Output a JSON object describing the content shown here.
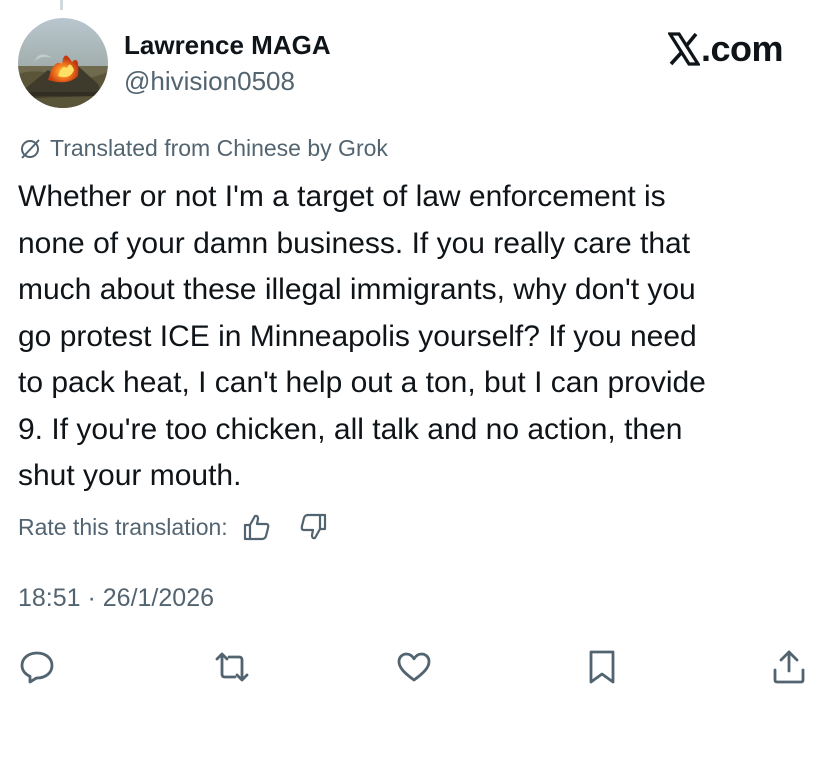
{
  "brand": {
    "label": ".com",
    "icon": "x-logo-icon"
  },
  "author": {
    "display_name": "Lawrence MAGA",
    "handle": "@hivision0508",
    "avatar_icon": "bonfire-avatar"
  },
  "translation": {
    "notice": "Translated from Chinese by Grok",
    "icon": "grok-icon"
  },
  "tweet": {
    "text": "Whether or not I'm a target of law enforcement is\nnone of your damn business. If you really care that\nmuch about these illegal immigrants, why don't you\ngo protest ICE in Minneapolis yourself? If you need\nto pack heat, I can't help out a ton, but I can provide\n9. If you're too chicken, all talk and no action, then\nshut your mouth."
  },
  "rating": {
    "label": "Rate this translation:",
    "up_icon": "thumbs-up-icon",
    "down_icon": "thumbs-down-icon"
  },
  "timestamp": "18:51 · 26/1/2026",
  "actions": [
    {
      "name": "reply",
      "icon": "reply-icon"
    },
    {
      "name": "repost",
      "icon": "repost-icon"
    },
    {
      "name": "like",
      "icon": "heart-icon"
    },
    {
      "name": "bookmark",
      "icon": "bookmark-icon"
    },
    {
      "name": "share",
      "icon": "share-icon"
    }
  ],
  "colors": {
    "text_primary": "#0f1419",
    "text_secondary": "#536471",
    "thread_line": "#cfd9de"
  }
}
